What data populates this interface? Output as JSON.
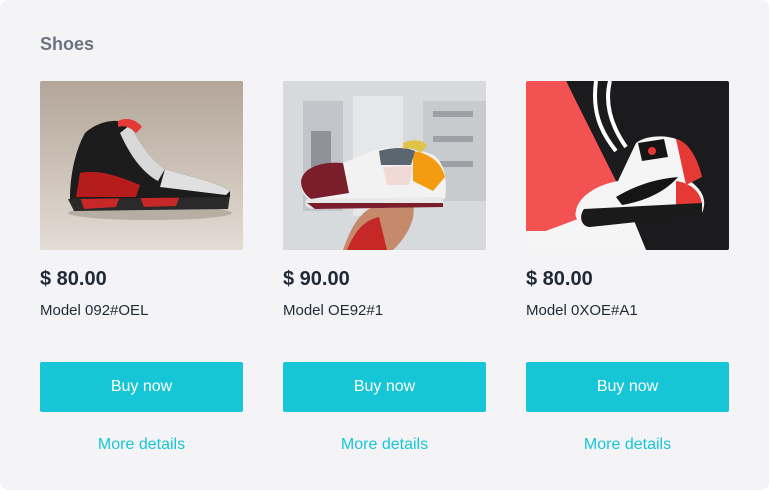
{
  "section": {
    "title": "Shoes"
  },
  "colors": {
    "accent": "#17c6d6",
    "background": "#f4f4f7",
    "text": "#1f2937"
  },
  "products": [
    {
      "price": "$ 80.00",
      "model": "Model 092#OEL",
      "buy_label": "Buy now",
      "details_label": "More details",
      "image": "black-red-high-top-sneaker"
    },
    {
      "price": "$ 90.00",
      "model": "Model OE92#1",
      "buy_label": "Buy now",
      "details_label": "More details",
      "image": "white-maroon-orange-runner-in-hand"
    },
    {
      "price": "$ 80.00",
      "model": "Model 0XOE#A1",
      "buy_label": "Buy now",
      "details_label": "More details",
      "image": "white-black-red-mid-top-sneaker"
    }
  ]
}
